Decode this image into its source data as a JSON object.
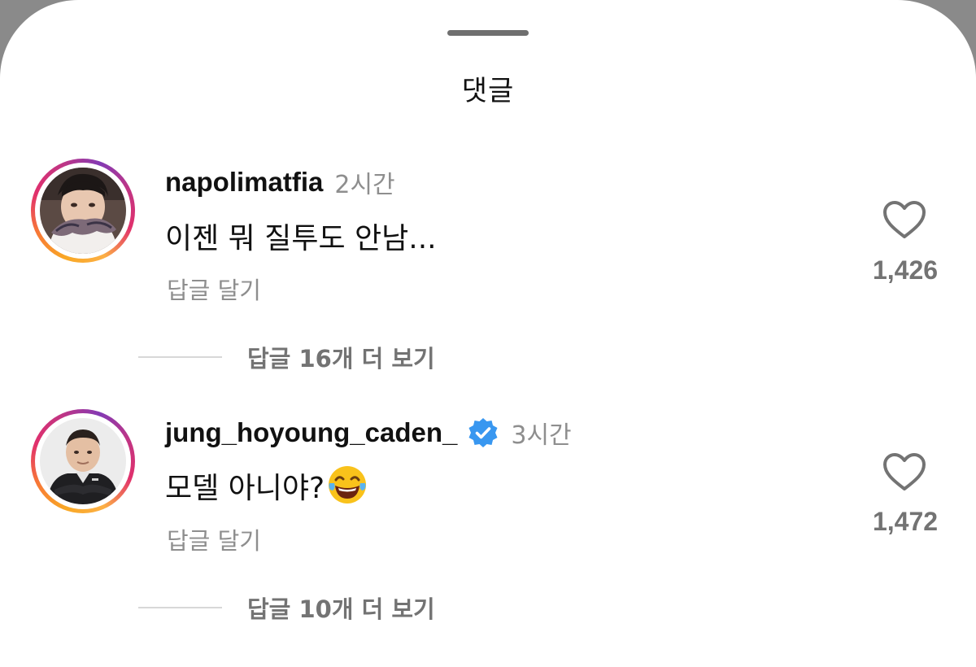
{
  "sheet": {
    "title": "댓글"
  },
  "comments": [
    {
      "username": "napolimatfia",
      "verified": false,
      "time": "2시간",
      "text": "이젠 뭐 질투도 안남...",
      "reply_label": "답글 달기",
      "likes": "1,426",
      "view_replies": "답글 16개 더 보기",
      "avatar_icon": "person-tattoo-avatar"
    },
    {
      "username": "jung_hoyoung_caden_",
      "verified": true,
      "time": "3시간",
      "text": "모델 아니야?",
      "emoji": "tears-of-joy-emoji",
      "reply_label": "답글 달기",
      "likes": "1,472",
      "view_replies": "답글 10개 더 보기",
      "avatar_icon": "chef-avatar"
    }
  ],
  "colors": {
    "background": "#ffffff",
    "text_primary": "#111111",
    "text_secondary": "#8e8e8e",
    "verified_badge": "#3897f0",
    "story_ring": [
      "#f9a825",
      "#e1306c",
      "#833ab4"
    ]
  }
}
